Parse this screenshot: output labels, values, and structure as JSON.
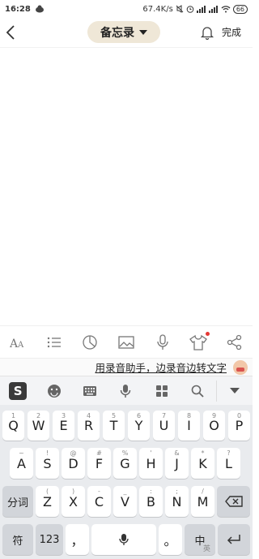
{
  "status": {
    "time": "16:28",
    "net_speed": "67.4K/s",
    "battery": "66"
  },
  "header": {
    "title": "备忘录",
    "done_label": "完成"
  },
  "format_toolbar": {
    "icons": [
      "text-style-icon",
      "list-icon",
      "chart-icon",
      "image-icon",
      "microphone-icon",
      "shirt-icon",
      "share-icon"
    ]
  },
  "suggestion": {
    "text": "用录音助手，边录音边转文字"
  },
  "ime_toolbar": {
    "logo": "S",
    "icons": [
      "sogou-logo",
      "emoji-icon",
      "keyboard-icon",
      "voice-icon",
      "apps-icon",
      "search-icon",
      "collapse-icon"
    ]
  },
  "keyboard": {
    "row1": [
      {
        "k": "Q",
        "h": "1"
      },
      {
        "k": "W",
        "h": "2"
      },
      {
        "k": "E",
        "h": "3"
      },
      {
        "k": "R",
        "h": "4"
      },
      {
        "k": "T",
        "h": "5"
      },
      {
        "k": "Y",
        "h": "6"
      },
      {
        "k": "U",
        "h": "7"
      },
      {
        "k": "I",
        "h": "8"
      },
      {
        "k": "O",
        "h": "9"
      },
      {
        "k": "P",
        "h": "0"
      }
    ],
    "row2": [
      {
        "k": "A",
        "h": "~"
      },
      {
        "k": "S",
        "h": "!"
      },
      {
        "k": "D",
        "h": "@"
      },
      {
        "k": "F",
        "h": "#"
      },
      {
        "k": "G",
        "h": "%"
      },
      {
        "k": "H",
        "h": "'"
      },
      {
        "k": "J",
        "h": "&"
      },
      {
        "k": "K",
        "h": "*"
      },
      {
        "k": "L",
        "h": "?"
      }
    ],
    "row3": [
      {
        "k": "Z",
        "h": "("
      },
      {
        "k": "X",
        "h": ")"
      },
      {
        "k": "C",
        "h": "-"
      },
      {
        "k": "V",
        "h": "_"
      },
      {
        "k": "B",
        "h": ":"
      },
      {
        "k": "N",
        "h": ";"
      },
      {
        "k": "M",
        "h": "/"
      }
    ],
    "fenci": "分词",
    "fu": "符",
    "num": "123",
    "comma": "，",
    "period": "。",
    "zh": "中",
    "zh_sub": "英"
  }
}
